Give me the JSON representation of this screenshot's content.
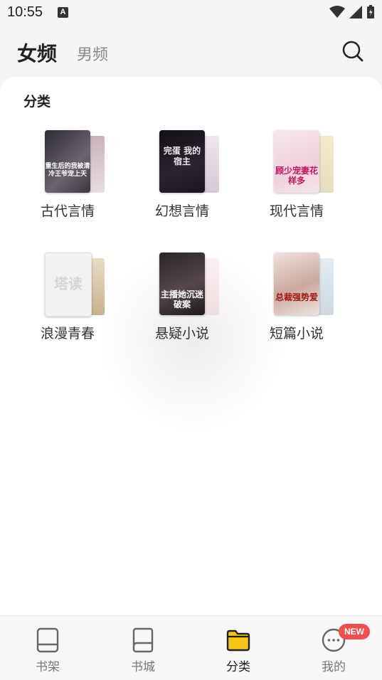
{
  "status": {
    "time": "10:55",
    "notif_glyph": "A"
  },
  "nav": {
    "tab_female": "女频",
    "tab_male": "男频",
    "search_icon": "search-icon"
  },
  "section": {
    "title": "分类"
  },
  "categories": [
    {
      "label": "古代言情",
      "cover_text": "重生后的我被清冷王爷宠上天",
      "colors": [
        "#3d3a43",
        "#c9b4bc"
      ]
    },
    {
      "label": "幻想言情",
      "cover_text": "完蛋 我的宿主",
      "colors": [
        "#1a1620",
        "#e6dde6"
      ]
    },
    {
      "label": "现代言情",
      "cover_text": "顾少宠妻花样多",
      "colors": [
        "#f3dfe8",
        "#efe8cf"
      ]
    },
    {
      "label": "浪漫青春",
      "cover_text": "塔读",
      "colors": [
        "#f2f2f2",
        "#d9c6a8"
      ]
    },
    {
      "label": "悬疑小说",
      "cover_text": "主播她沉迷破案",
      "colors": [
        "#2a2529",
        "#f4e6e8"
      ]
    },
    {
      "label": "短篇小说",
      "cover_text": "总裁强势爱",
      "colors": [
        "#e9d6d0",
        "#dfe6ec"
      ]
    }
  ],
  "bottom": {
    "items": [
      {
        "label": "书架",
        "icon": "bookshelf-icon"
      },
      {
        "label": "书城",
        "icon": "bookstore-icon"
      },
      {
        "label": "分类",
        "icon": "category-folder-icon"
      },
      {
        "label": "我的",
        "icon": "profile-chat-icon"
      }
    ],
    "badge": "NEW",
    "active_color": "#f5c518"
  }
}
